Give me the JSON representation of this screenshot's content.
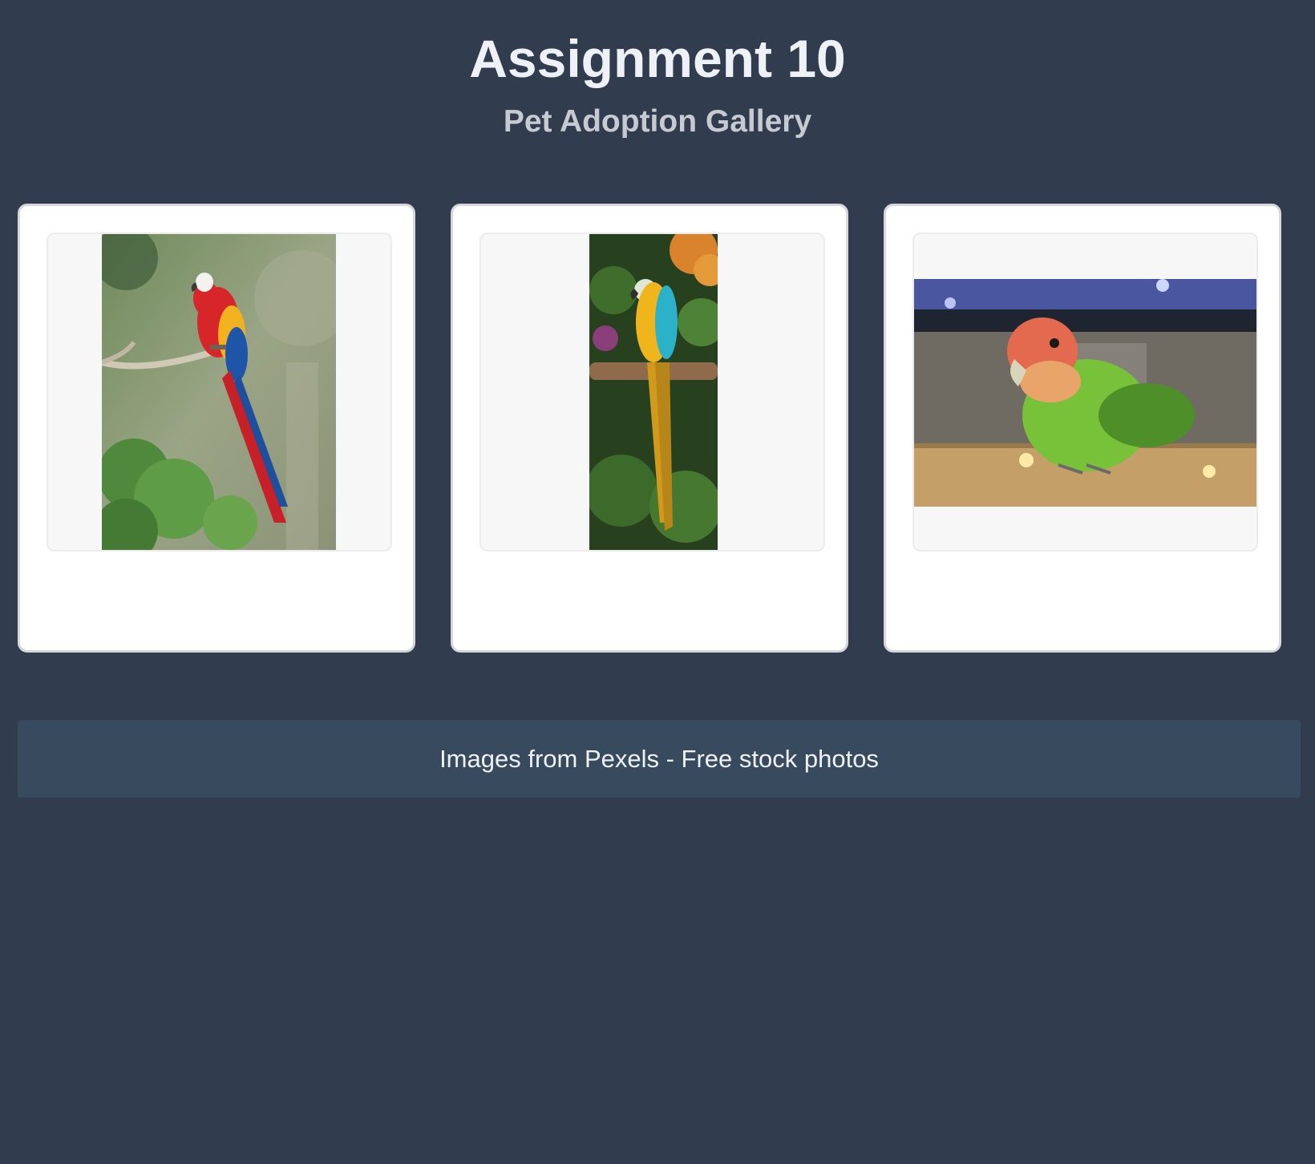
{
  "header": {
    "title": "Assignment 10",
    "subtitle": "Pet Adoption Gallery"
  },
  "gallery": {
    "items": [
      {
        "image_icon": "scarlet-macaw-photo"
      },
      {
        "image_icon": "blue-and-gold-macaw-photo"
      },
      {
        "image_icon": "lovebird-photo"
      }
    ]
  },
  "footer": {
    "text": "Images from Pexels - Free stock photos"
  },
  "colors": {
    "background": "#313d4f",
    "footer_background": "#384a5e",
    "card_background": "#ffffff"
  }
}
